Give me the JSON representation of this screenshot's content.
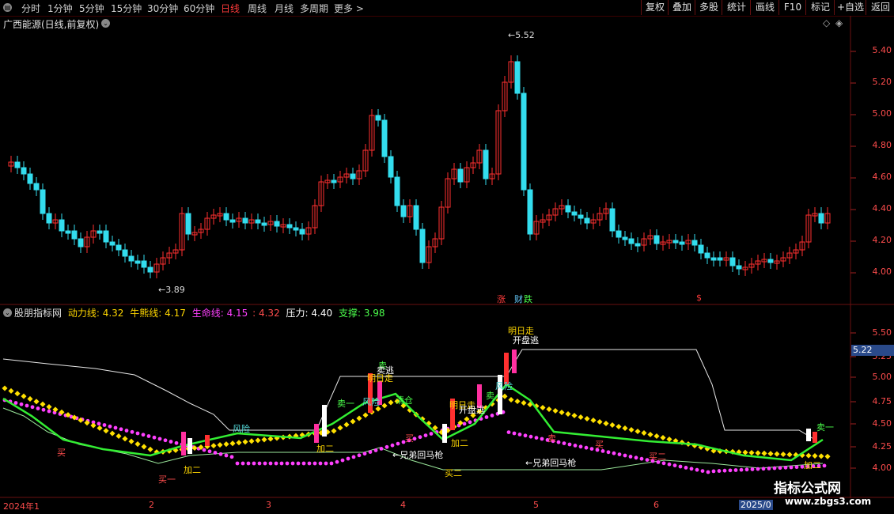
{
  "toolbar": {
    "periods": [
      "分时",
      "1分钟",
      "5分钟",
      "15分钟",
      "30分钟",
      "60分钟",
      "日线",
      "周线",
      "月线",
      "多周期"
    ],
    "active_period": "日线",
    "more": "更多",
    "right_buttons": [
      "复权",
      "叠加",
      "多股",
      "统计",
      "画线",
      "F10",
      "标记",
      "+自选",
      "返回"
    ]
  },
  "main": {
    "title": "广西能源(日线,前复权)",
    "y_labels": [
      "5.40",
      "5.20",
      "5.00",
      "4.80",
      "4.60",
      "4.40",
      "4.20",
      "4.00"
    ],
    "high_label": "5.52",
    "low_label": "3.89",
    "event_tags": [
      "涨",
      "财",
      "跌",
      "$"
    ]
  },
  "indicator": {
    "name": "股朋指标网",
    "lines": [
      {
        "label": "动力线:",
        "value": "4.32",
        "color": "#ffd700"
      },
      {
        "label": "牛熊线:",
        "value": "4.17",
        "color": "#ffd700"
      },
      {
        "label": "生命线:",
        "value": "4.15",
        "color": "#ff40ff"
      },
      {
        "label": ":",
        "value": "4.32",
        "color": "#ff4d4d"
      },
      {
        "label": "压力:",
        "value": "4.40",
        "color": "#ffffff"
      },
      {
        "label": "支撑:",
        "value": "3.98",
        "color": "#4cff4c"
      }
    ],
    "y_labels": [
      "5.50",
      "5.25",
      "5.00",
      "4.75",
      "4.50",
      "4.25",
      "4.00"
    ],
    "current_price": "5.22",
    "signals": [
      "风险",
      "卖一",
      "风险",
      "清仓",
      "卖",
      "卖逃",
      "明日走",
      "明日走",
      "开盘逃",
      "卖",
      "明日走",
      "开盘逃",
      "风险",
      "加二",
      "买一",
      "买二",
      "加二",
      "←兄弟回马枪",
      "←兄弟回马枪",
      "买",
      "买",
      "买",
      "卖一",
      "加二",
      "卖",
      "加二",
      "买二"
    ]
  },
  "dates": [
    "2024年1",
    "2",
    "3",
    "4",
    "5",
    "6",
    "2025/0"
  ],
  "watermark": {
    "line1": "指标公式网",
    "line2": "www.zbgs3.com"
  }
}
